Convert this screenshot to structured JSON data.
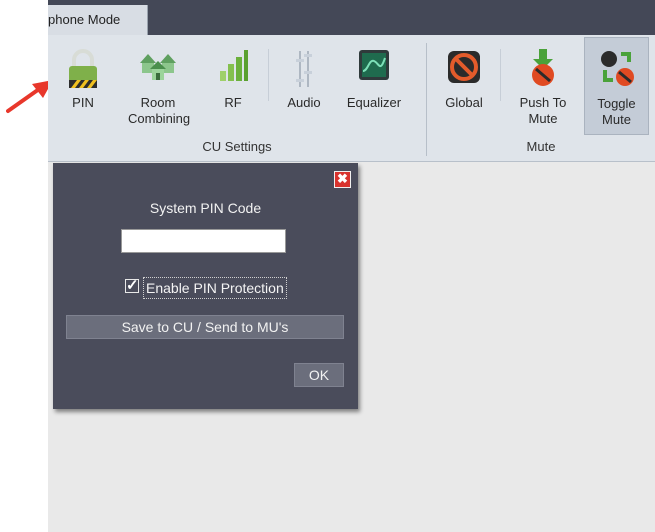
{
  "tab": {
    "label": "phone Mode"
  },
  "ribbon": {
    "cu_buttons": [
      {
        "label": "PIN",
        "icon": "padlock-icon"
      },
      {
        "label": "Room Combining",
        "icon": "room-combining-icon"
      },
      {
        "label": "RF",
        "icon": "rf-signal-icon"
      },
      {
        "label": "Audio",
        "icon": "audio-sliders-icon"
      },
      {
        "label": "Equalizer",
        "icon": "equalizer-icon"
      }
    ],
    "mute_buttons": [
      {
        "label": "Global",
        "icon": "global-mute-icon"
      },
      {
        "label": "Push To Mute",
        "icon": "push-to-mute-icon"
      },
      {
        "label": "Toggle Mute",
        "icon": "toggle-mute-icon"
      }
    ],
    "groups": {
      "cu_settings": "CU Settings",
      "mute": "Mute"
    }
  },
  "dialog": {
    "close_icon": "✖",
    "pin_label": "System PIN Code",
    "pin_value": "",
    "enable_checked": true,
    "enable_label": "Enable PIN Protection",
    "save_label": "Save to CU / Send to MU's",
    "ok_label": "OK"
  },
  "colors": {
    "annotation_arrow": "#e8372b",
    "dialog_bg": "#4a4c5b",
    "ribbon_bg": "#dfe4ea"
  }
}
